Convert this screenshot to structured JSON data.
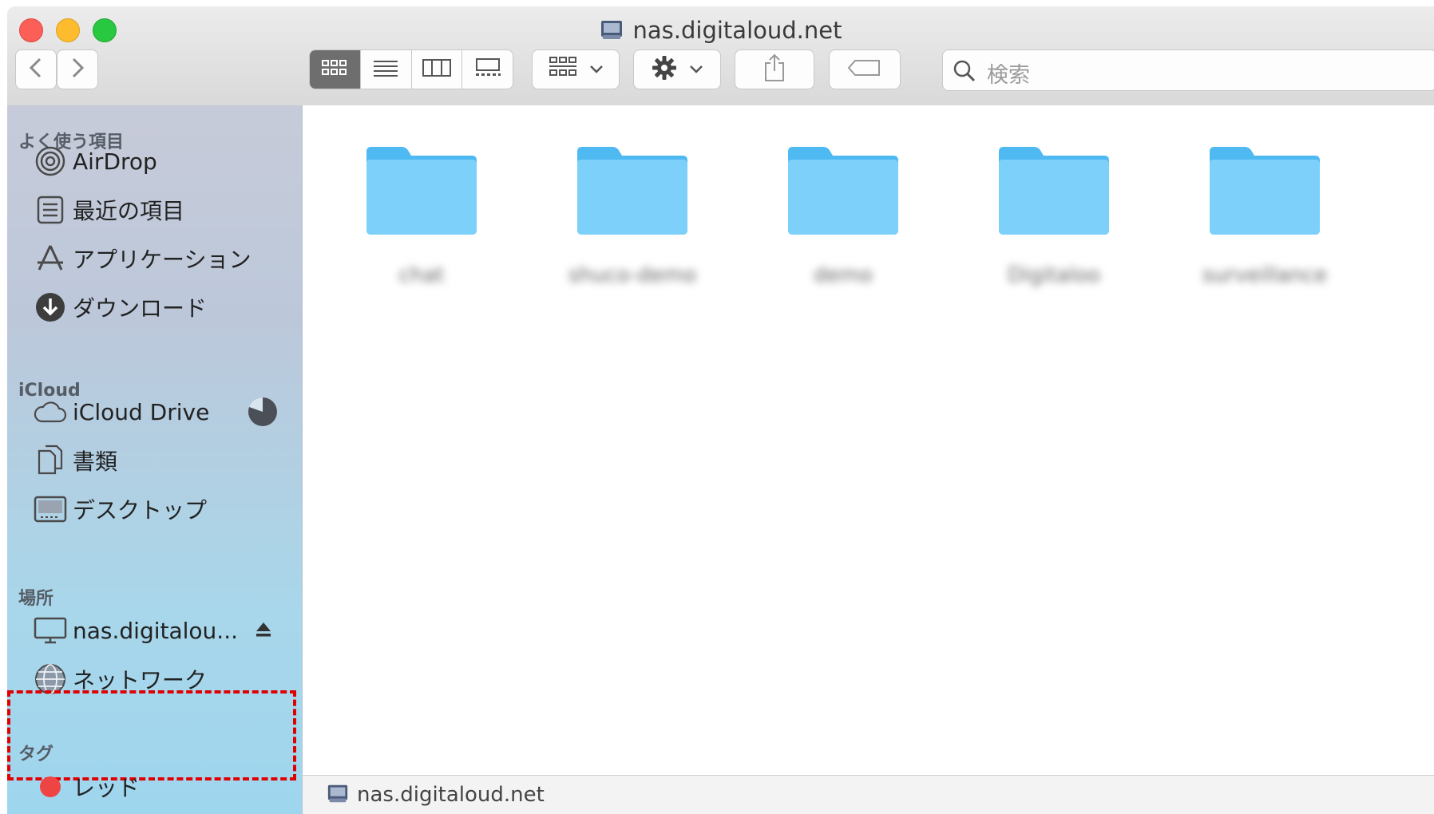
{
  "window": {
    "title": "nas.digitaloud.net"
  },
  "toolbar": {
    "search_placeholder": "検索",
    "icons": [
      "back-icon",
      "forward-icon",
      "icon-view",
      "list-view",
      "column-view",
      "gallery-view",
      "group-icon",
      "gear-icon",
      "share-icon",
      "tag-icon"
    ]
  },
  "sidebar": {
    "favorites_header": "よく使う項目",
    "favorites": [
      {
        "label": "AirDrop",
        "icon": "airdrop-icon"
      },
      {
        "label": "最近の項目",
        "icon": "recents-icon"
      },
      {
        "label": "アプリケーション",
        "icon": "applications-icon"
      },
      {
        "label": "ダウンロード",
        "icon": "downloads-icon"
      }
    ],
    "icloud_header": "iCloud",
    "icloud": [
      {
        "label": "iCloud Drive",
        "icon": "cloud-icon"
      },
      {
        "label": "書類",
        "icon": "documents-icon"
      },
      {
        "label": "デスクトップ",
        "icon": "desktop-icon"
      }
    ],
    "locations_header": "場所",
    "locations": [
      {
        "label": "nas.digitalou...",
        "icon": "monitor-icon"
      },
      {
        "label": "ネットワーク",
        "icon": "network-icon"
      }
    ],
    "tags_header": "タグ",
    "tags": [
      {
        "label": "レッド",
        "color": "#ef4444"
      }
    ]
  },
  "content": {
    "folders": [
      {
        "name": "chat"
      },
      {
        "name": "shuco-demo"
      },
      {
        "name": "demo"
      },
      {
        "name": "Digitaloo"
      },
      {
        "name": "surveillance"
      }
    ]
  },
  "pathbar": {
    "path": "nas.digitaloud.net"
  }
}
